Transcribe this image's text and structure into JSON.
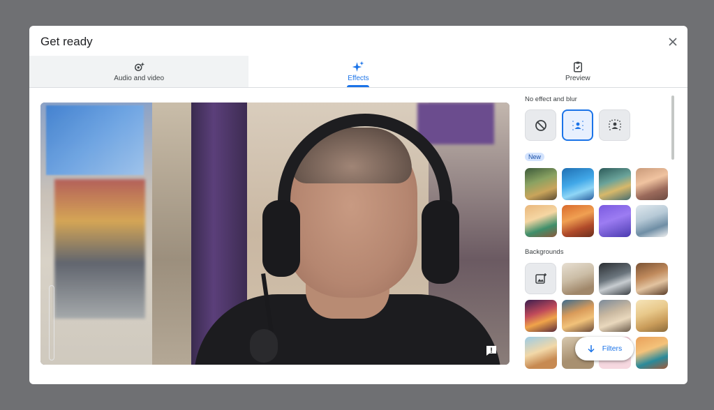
{
  "dialog": {
    "title": "Get ready"
  },
  "tabs": [
    {
      "label": "Audio and video",
      "icon": "settings-sparkle-icon"
    },
    {
      "label": "Effects",
      "icon": "sparkle-icon",
      "selected": true
    },
    {
      "label": "Preview",
      "icon": "clipboard-check-icon"
    }
  ],
  "effects_panel": {
    "no_effect_section": "No effect and blur",
    "new_badge": "New",
    "backgrounds_section": "Backgrounds",
    "filters_button": "Filters"
  },
  "colors": {
    "accent": "#1a73e8",
    "badge_bg": "#d3e3fd",
    "backdrop": "#6f7073"
  }
}
